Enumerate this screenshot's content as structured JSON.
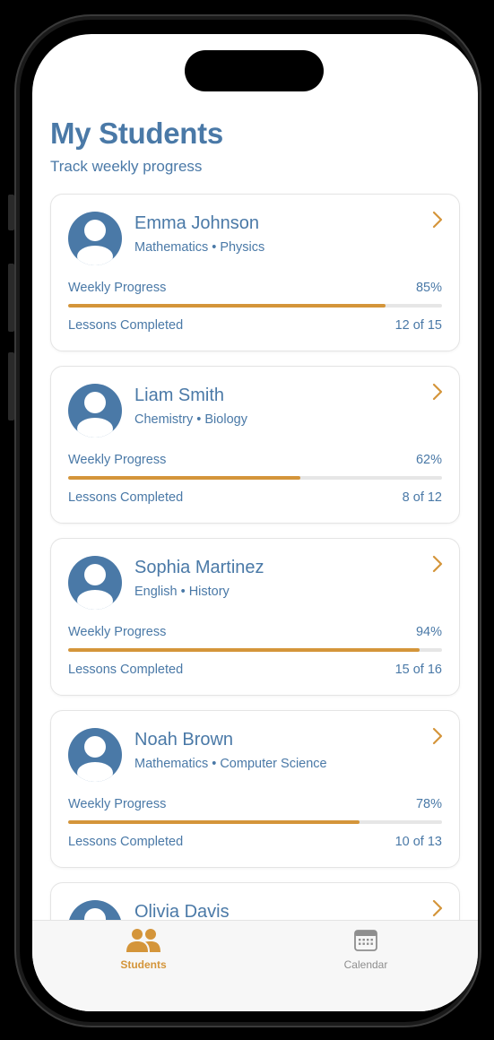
{
  "header": {
    "title": "My Students",
    "subtitle": "Track weekly progress"
  },
  "labels": {
    "progress": "Weekly Progress",
    "lessons": "Lessons Completed"
  },
  "students": [
    {
      "name": "Emma Johnson",
      "subjects": "Mathematics • Physics",
      "progress_text": "85%",
      "progress": 0.85,
      "lessons": "12 of 15"
    },
    {
      "name": "Liam Smith",
      "subjects": "Chemistry • Biology",
      "progress_text": "62%",
      "progress": 0.62,
      "lessons": "8 of 12"
    },
    {
      "name": "Sophia Martinez",
      "subjects": "English • History",
      "progress_text": "94%",
      "progress": 0.94,
      "lessons": "15 of 16"
    },
    {
      "name": "Noah Brown",
      "subjects": "Mathematics • Computer Science",
      "progress_text": "78%",
      "progress": 0.78,
      "lessons": "10 of 13"
    },
    {
      "name": "Olivia Davis",
      "subjects": "",
      "progress_text": "",
      "progress": 0,
      "lessons": ""
    }
  ],
  "tabs": [
    {
      "label": "Students",
      "icon": "people-icon",
      "active": true
    },
    {
      "label": "Calendar",
      "icon": "calendar-icon",
      "active": false
    }
  ],
  "colors": {
    "primary": "#4a79a7",
    "accent": "#d4953a",
    "track": "#e6e6e6",
    "inactive": "#8e8e8e"
  }
}
